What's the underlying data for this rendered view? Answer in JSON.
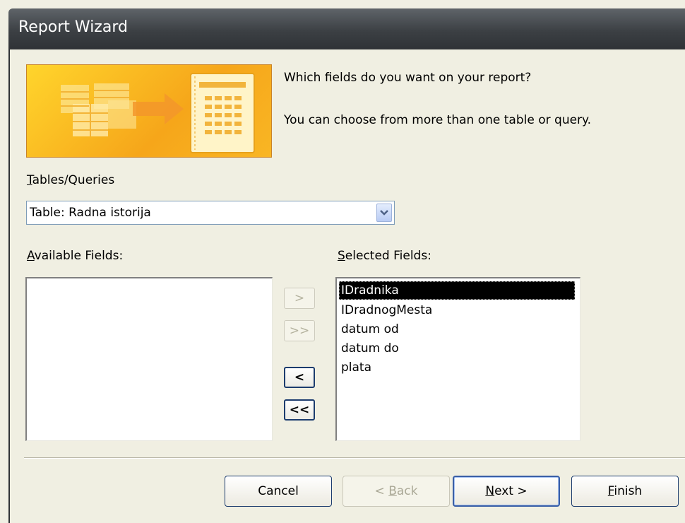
{
  "window": {
    "title": "Report Wizard"
  },
  "prompt": {
    "line1": "Which fields do you want on your report?",
    "line2": "You can choose from more than one table or query."
  },
  "tables_queries": {
    "label_prefix": "T",
    "label_rest": "ables/Queries",
    "selected": "Table: Radna istorija"
  },
  "available": {
    "label_prefix": "A",
    "label_rest": "vailable Fields:",
    "items": []
  },
  "selected_fields": {
    "label_prefix": "S",
    "label_rest": "elected Fields:",
    "items": [
      "IDradnika",
      "IDradnogMesta",
      "datum od",
      "datum do",
      "plata"
    ],
    "selected_index": 0
  },
  "move_buttons": {
    "add_one": ">",
    "add_all": ">>",
    "remove_one": "<",
    "remove_all": "<<"
  },
  "footer": {
    "cancel": "Cancel",
    "back_prefix": "< ",
    "back_key": "B",
    "back_rest": "ack",
    "next_key": "N",
    "next_rest": "ext >",
    "finish_key": "F",
    "finish_rest": "inish"
  },
  "colors": {
    "titlebar": "#3c4044",
    "banner": "#f6a61a",
    "selection": "#000000",
    "focus_border": "#1c3c6e"
  },
  "icons": {
    "banner": "report-wizard-illustration",
    "dropdown": "chevron-down-icon"
  }
}
